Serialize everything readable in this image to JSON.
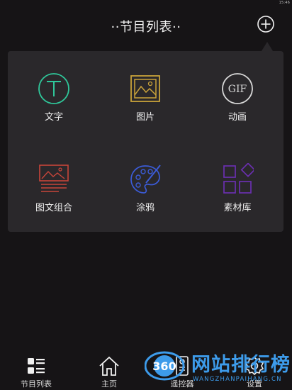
{
  "status": {
    "time": "15:46"
  },
  "header": {
    "title": "··节目列表··"
  },
  "menu": {
    "items": [
      {
        "label": "文字",
        "icon": "text-T-icon",
        "color": "#2fc79a"
      },
      {
        "label": "图片",
        "icon": "picture-icon",
        "color": "#c9a23a"
      },
      {
        "label": "动画",
        "icon": "gif-icon",
        "color": "#d9d9d9"
      },
      {
        "label": "图文组合",
        "icon": "image-text-combo-icon",
        "color": "#c8453a"
      },
      {
        "label": "涂鸦",
        "icon": "palette-icon",
        "color": "#3b5bd6"
      },
      {
        "label": "素材库",
        "icon": "material-library-icon",
        "color": "#6a2fb0"
      }
    ]
  },
  "tabbar": {
    "tabs": [
      {
        "label": "节目列表",
        "icon": "program-list-icon"
      },
      {
        "label": "主页",
        "icon": "home-icon"
      },
      {
        "label": "遥控器",
        "icon": "remote-control-icon"
      },
      {
        "label": "设置",
        "icon": "settings-icon"
      }
    ]
  },
  "watermark": {
    "text": "网站排行榜",
    "prefix": "360",
    "sub": "WANGZHANPAIHANG.CN"
  }
}
